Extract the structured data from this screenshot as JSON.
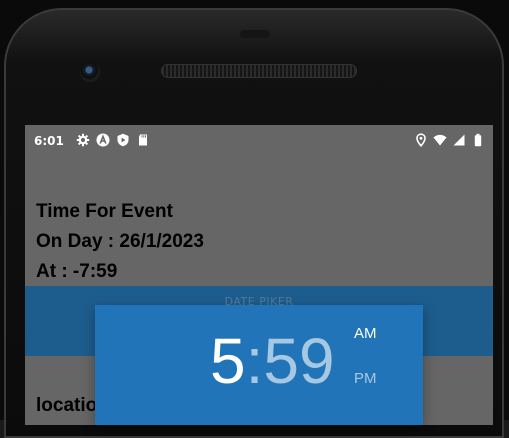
{
  "status_bar": {
    "time": "6:01",
    "left_icons": [
      "gear-icon",
      "a-circle-icon",
      "play-shield-icon",
      "sd-card-icon"
    ],
    "right_icons": [
      "location-pin-icon",
      "wifi-icon",
      "signal-icon",
      "battery-icon"
    ]
  },
  "event": {
    "title": "Time For Event",
    "day": "On Day : 26/1/2023",
    "at": "At : -7:59"
  },
  "band": {
    "label": "DATE PIKER"
  },
  "location": {
    "label": "locatio"
  },
  "time_picker": {
    "hour": "5",
    "separator": ":",
    "minute": "59",
    "am": "AM",
    "pm": "PM",
    "selected_period": "AM"
  },
  "colors": {
    "screen_bg": "#666666",
    "band": "#1d5d8e",
    "picker_header": "#2074b7",
    "picker_inactive_text": "#a7c8e3"
  }
}
